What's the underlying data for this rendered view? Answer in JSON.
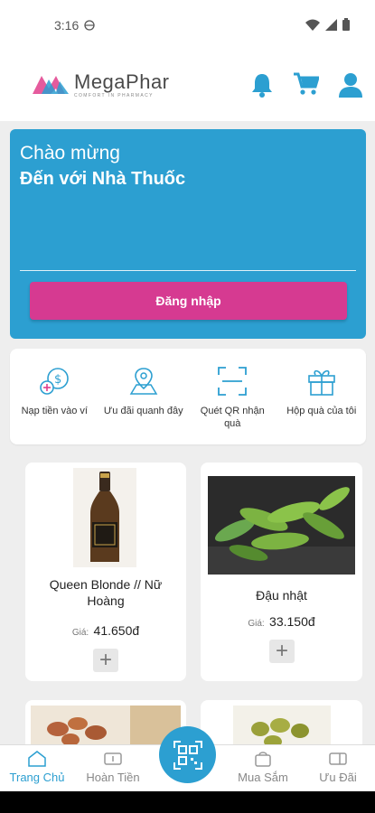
{
  "status_bar": {
    "time": "3:16"
  },
  "header": {
    "brand_name": "MegaPhar",
    "brand_tagline": "COMFORT IN PHARMACY",
    "brand_colors": {
      "pink": "#e03e8c",
      "blue": "#2c9fd1"
    }
  },
  "welcome": {
    "line1": "Chào mừng",
    "line2": "Đến với Nhà Thuốc",
    "login_label": "Đăng nhập"
  },
  "quick_actions": [
    {
      "label": "Nạp tiền vào ví",
      "icon": "wallet-topup-icon"
    },
    {
      "label": "Ưu đãi quanh đây",
      "icon": "map-pin-icon"
    },
    {
      "label": "Quét QR nhận quà",
      "icon": "qr-scan-icon"
    },
    {
      "label": "Hộp quà của tôi",
      "icon": "gift-icon"
    }
  ],
  "products": [
    {
      "name": "Queen Blonde // Nữ Hoàng",
      "price_label": "Giá:",
      "price": "41.650đ"
    },
    {
      "name": "Đậu nhật",
      "price_label": "Giá:",
      "price": "33.150đ"
    }
  ],
  "bottom_nav": [
    {
      "label": "Trang Chủ",
      "active": true
    },
    {
      "label": "Hoàn Tiền",
      "active": false
    },
    {
      "label": "Mua Sắm",
      "active": false
    },
    {
      "label": "Ưu Đãi",
      "active": false
    }
  ],
  "colors": {
    "primary": "#2c9fd1",
    "login": "#d63a91",
    "background": "#eeeeee"
  }
}
